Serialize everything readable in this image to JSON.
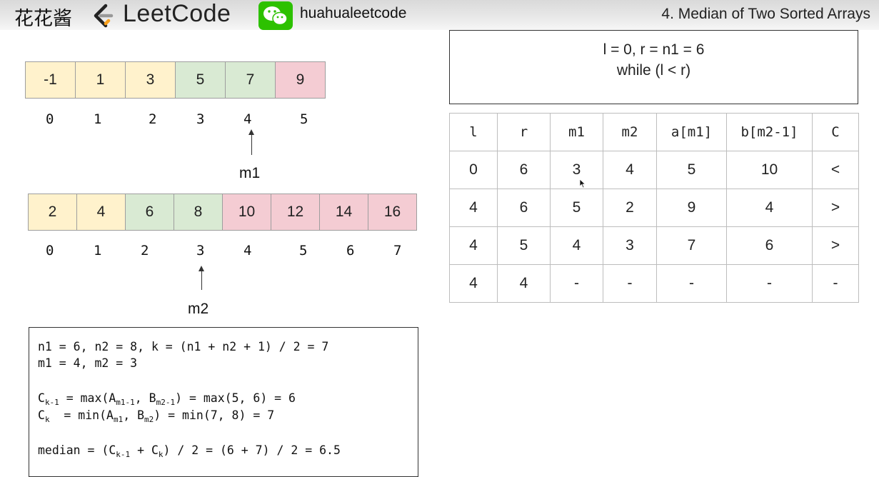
{
  "header": {
    "brand_cn": "花花酱",
    "brand_logo_text": "LeetCode",
    "handle": "huahualeetcode",
    "problem_title": "4. Median of Two Sorted Arrays",
    "colors": {
      "logo_orange": "#f89f1b",
      "wechat_green": "#2dc100"
    }
  },
  "array_a": {
    "values": [
      "-1",
      "1",
      "3",
      "5",
      "7",
      "9"
    ],
    "indices": [
      "0",
      "1",
      "2",
      "3",
      "4",
      "5"
    ],
    "pointer_label": "m1"
  },
  "array_b": {
    "values": [
      "2",
      "4",
      "6",
      "8",
      "10",
      "12",
      "14",
      "16"
    ],
    "indices": [
      "0",
      "1",
      "2",
      "3",
      "4",
      "5",
      "6",
      "7"
    ],
    "pointer_label": "m2"
  },
  "colors": {
    "left_part": "#fff2cc",
    "split_part": "#d9ead3",
    "right_part": "#f4ccd3"
  },
  "code": {
    "line1": "n1 = 6, n2 = 8, k = (n1 + n2 + 1) / 2 = 7",
    "line2": "m1 = 4, m2 = 3",
    "ck1": {
      "C": "C",
      "Csub": "k-1",
      "t1": " = max(A",
      "Asub": "m1-1",
      "t2": ", B",
      "Bsub": "m2-1",
      "t3": ") = max(5, 6) = 6"
    },
    "ck": {
      "C": "C",
      "Csub": "k",
      "t1": "  = min(A",
      "Asub": "m1",
      "t2": ", B",
      "Bsub": "m2",
      "t3": ") = min(7, 8) = 7"
    },
    "median": {
      "t0": "median = (C",
      "s1": "k-1",
      "t1": " + C",
      "s2": "k",
      "t2": ") / 2 = (6 + 7) / 2 = 6.5"
    }
  },
  "condition": {
    "line1": "l = 0, r = n1 = 6",
    "line2": "while (l < r)"
  },
  "trace_table": {
    "headers": [
      "l",
      "r",
      "m1",
      "m2",
      "a[m1]",
      "b[m2-1]",
      "C"
    ],
    "rows": [
      [
        "0",
        "6",
        "3",
        "4",
        "5",
        "10",
        "<"
      ],
      [
        "4",
        "6",
        "5",
        "2",
        "9",
        "4",
        ">"
      ],
      [
        "4",
        "5",
        "4",
        "3",
        "7",
        "6",
        ">"
      ],
      [
        "4",
        "4",
        "-",
        "-",
        "-",
        "-",
        "-"
      ]
    ]
  }
}
